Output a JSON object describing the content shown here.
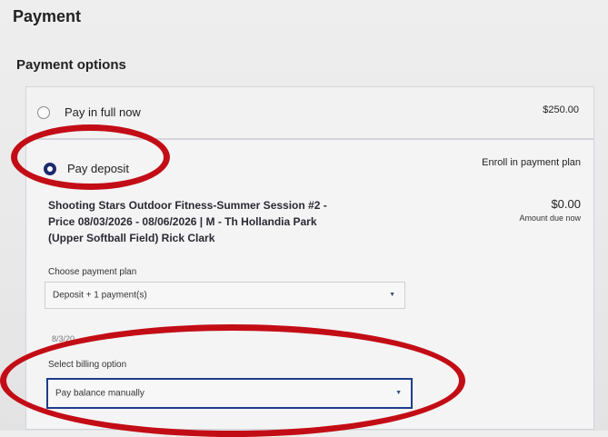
{
  "page": {
    "title": "Payment",
    "section_title": "Payment options"
  },
  "options": {
    "full": {
      "label": "Pay in full now",
      "amount": "$250.00",
      "selected": false
    },
    "deposit": {
      "label": "Pay deposit",
      "right_label": "Enroll in payment plan",
      "selected": true
    }
  },
  "enrollment": {
    "line1": "Shooting Stars Outdoor Fitness-Summer Session #2 -",
    "line2": "Price 08/03/2026 - 08/06/2026 | M - Th Hollandia Park",
    "line3": "(Upper Softball Field) Rick Clark",
    "amount": "$0.00",
    "amount_caption": "Amount due now"
  },
  "payment_plan": {
    "label": "Choose payment plan",
    "value": "Deposit + 1 payment(s)"
  },
  "partial_date": "8/3/20",
  "billing": {
    "label": "Select billing option",
    "value": "Pay balance manually"
  },
  "annotation_color": "#c30d16",
  "icons": {
    "dropdown": "chevron-down-icon"
  }
}
